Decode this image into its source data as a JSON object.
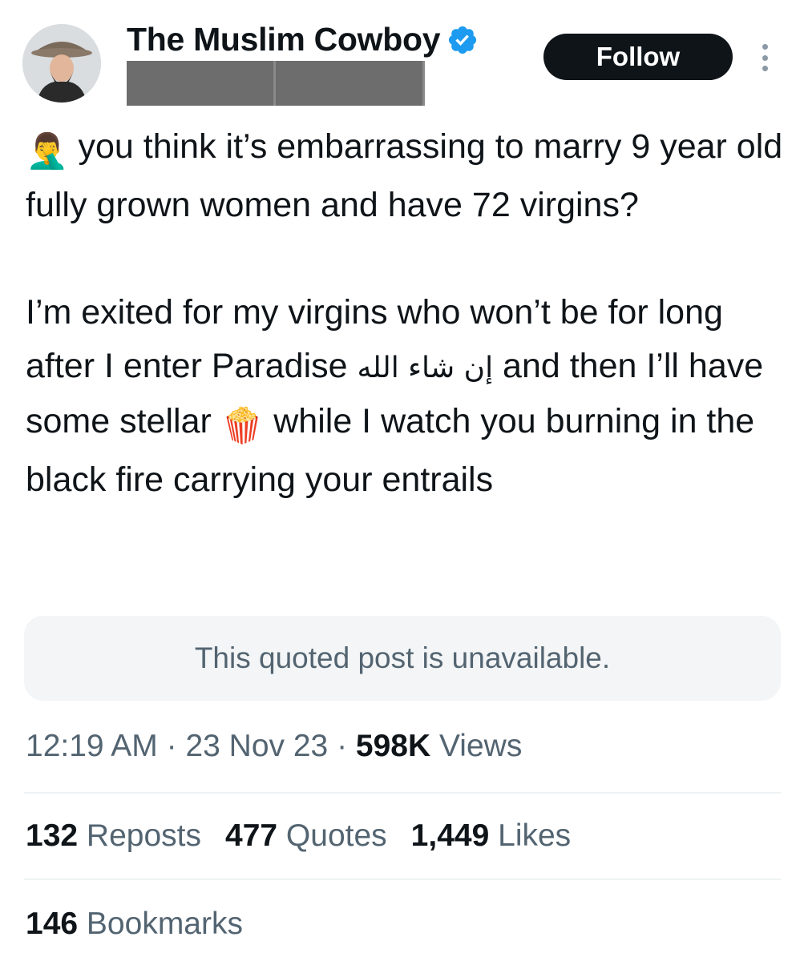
{
  "author": {
    "display_name": "The Muslim Cowboy",
    "handle": "",
    "verified_icon": "verified-badge-icon",
    "avatar_icon": "profile-photo"
  },
  "follow_label": "Follow",
  "more_icon": "more-options-icon",
  "tweet": {
    "facepalm_emoji": "🤦‍♂️",
    "line1": " you think it’s embarrassing to marry 9 year old fully grown women and have 72 virgins?",
    "para2_a": "I’m exited for my virgins who won’t be for long after I enter Paradise ",
    "arabic": "إن شاء الله",
    "para2_b": " and then I’ll have some stellar ",
    "popcorn_emoji": "🍿",
    "para2_c": " while I watch you burning in the black fire carrying your entrails"
  },
  "quoted_post": "This quoted post is unavailable.",
  "meta": {
    "time": "12:19 AM",
    "date": "23 Nov 23",
    "views_count": "598K",
    "views_label": "Views"
  },
  "stats": {
    "reposts_count": "132",
    "reposts_label": "Reposts",
    "quotes_count": "477",
    "quotes_label": "Quotes",
    "likes_count": "1,449",
    "likes_label": "Likes",
    "bookmarks_count": "146",
    "bookmarks_label": "Bookmarks"
  },
  "colors": {
    "text_primary": "#0f1419",
    "text_secondary": "#536471",
    "verified_blue": "#1d9bf0",
    "follow_bg": "#0f1419",
    "quote_bg": "#f3f5f6",
    "divider": "#eff3f4"
  }
}
